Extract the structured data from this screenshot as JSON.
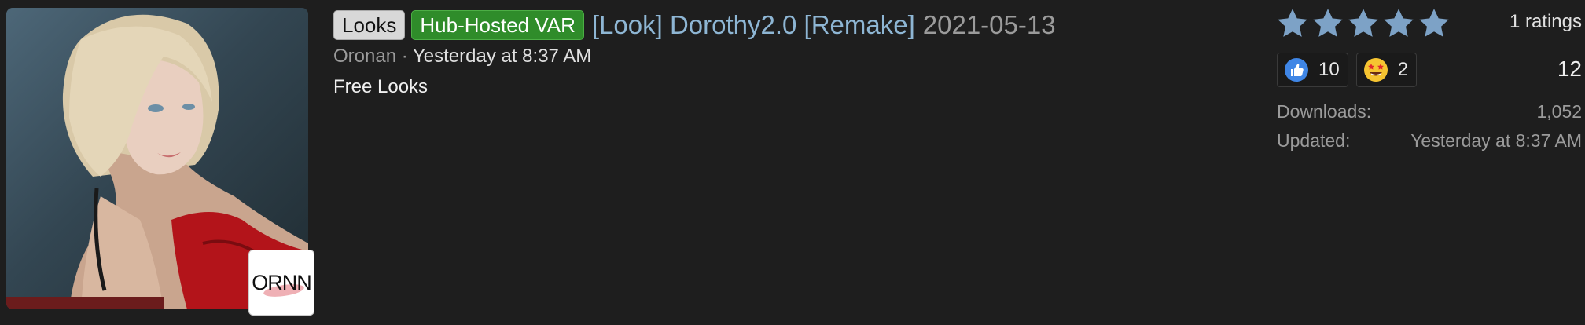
{
  "resource": {
    "thumbnail": {
      "description_icon": "character-portrait-image"
    },
    "avatar_badge": {
      "text": "ORNN"
    },
    "prefix_tags": [
      {
        "label": "Looks",
        "color": "#d8d8d8"
      },
      {
        "label": "Hub-Hosted VAR",
        "color": "#2f8c2a"
      }
    ],
    "title": "[Look] Dorothy2.0 [Remake]",
    "version": "2021-05-13",
    "author": "Oronan",
    "separator": " · ",
    "posted_time": "Yesterday at 8:37 AM",
    "tagline": "Free Looks"
  },
  "sidebar": {
    "rating": {
      "stars": 5,
      "max_stars": 5,
      "star_color": "#7da2c6",
      "ratings_text": "1 ratings"
    },
    "reactions": [
      {
        "icon": "thumbs-up-icon",
        "count": "10"
      },
      {
        "icon": "star-struck-emoji-icon",
        "count": "2"
      }
    ],
    "reaction_total": "12",
    "stats": {
      "downloads_label": "Downloads:",
      "downloads_value": "1,052",
      "updated_label": "Updated:",
      "updated_value": "Yesterday at 8:37 AM"
    }
  },
  "colors": {
    "background": "#1e1e1e",
    "link": "#8eb6d4",
    "muted": "#9b9b9b"
  }
}
